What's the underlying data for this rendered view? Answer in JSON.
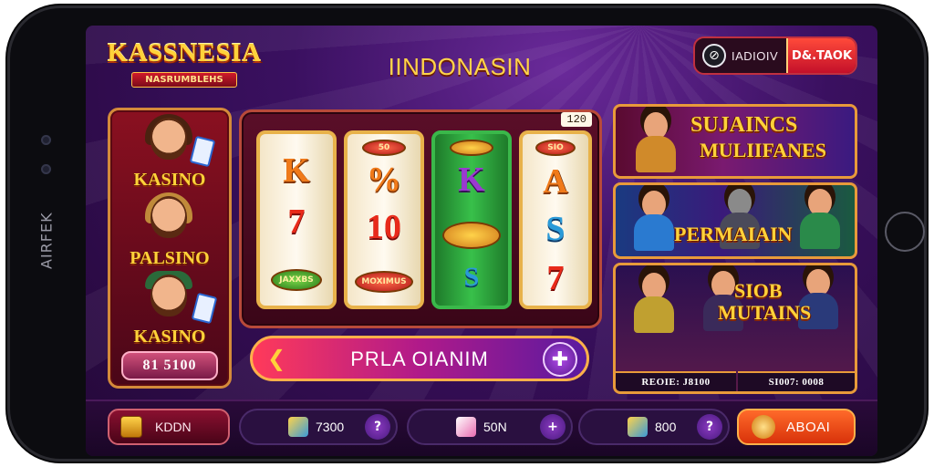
{
  "device": {
    "side_label": "AIRFEK"
  },
  "header": {
    "logo_title": "KASSNESIA",
    "logo_subtitle": "NASRUMBLEHS",
    "title": "IINDONASIN",
    "account_label": "IADIOIV",
    "account_button": "D&.TAOK"
  },
  "left_panel": {
    "items": [
      {
        "label": "KASINO",
        "icon": "woman-with-cards"
      },
      {
        "label": "PALSINO",
        "icon": "woman-portrait"
      },
      {
        "label": "KASINO",
        "icon": "man-with-cards"
      }
    ],
    "value": "81 5100"
  },
  "slot": {
    "counter": "120",
    "reels": [
      {
        "symbols": [
          "K",
          "7"
        ],
        "badge": "JAXXBS"
      },
      {
        "symbols": [
          "%",
          "10"
        ],
        "top_badge": "50",
        "badge": "MOXIMUS"
      },
      {
        "symbols": [
          "K",
          "S"
        ],
        "top_badge": "",
        "badge": ""
      },
      {
        "symbols": [
          "A",
          "S",
          "7"
        ],
        "top_badge": "SIO"
      }
    ],
    "play_label": "PRLA OIANIM"
  },
  "banners": [
    {
      "text_line1": "SUJAINCS",
      "text_line2": "MULIIFANES"
    },
    {
      "text": "PERMAIAIN"
    },
    {
      "text_line1": "SIOB",
      "text_line2": "MUTAINS",
      "caption_left": "REOIE: J8100",
      "caption_right": "SI007: 0008"
    }
  ],
  "bottom_bar": {
    "kbn_label": "KDDN",
    "chips": [
      {
        "value": "7300",
        "icon_color": "#3a9ad8"
      },
      {
        "value": "50N",
        "icon_color": "#e86ab0"
      },
      {
        "value": "800",
        "icon_color": "#3a9ad8"
      }
    ],
    "about_label": "ABOAI"
  },
  "colors": {
    "accent_gold": "#ffd23a",
    "accent_red": "#c4102a",
    "bg_purple": "#3a1060"
  }
}
